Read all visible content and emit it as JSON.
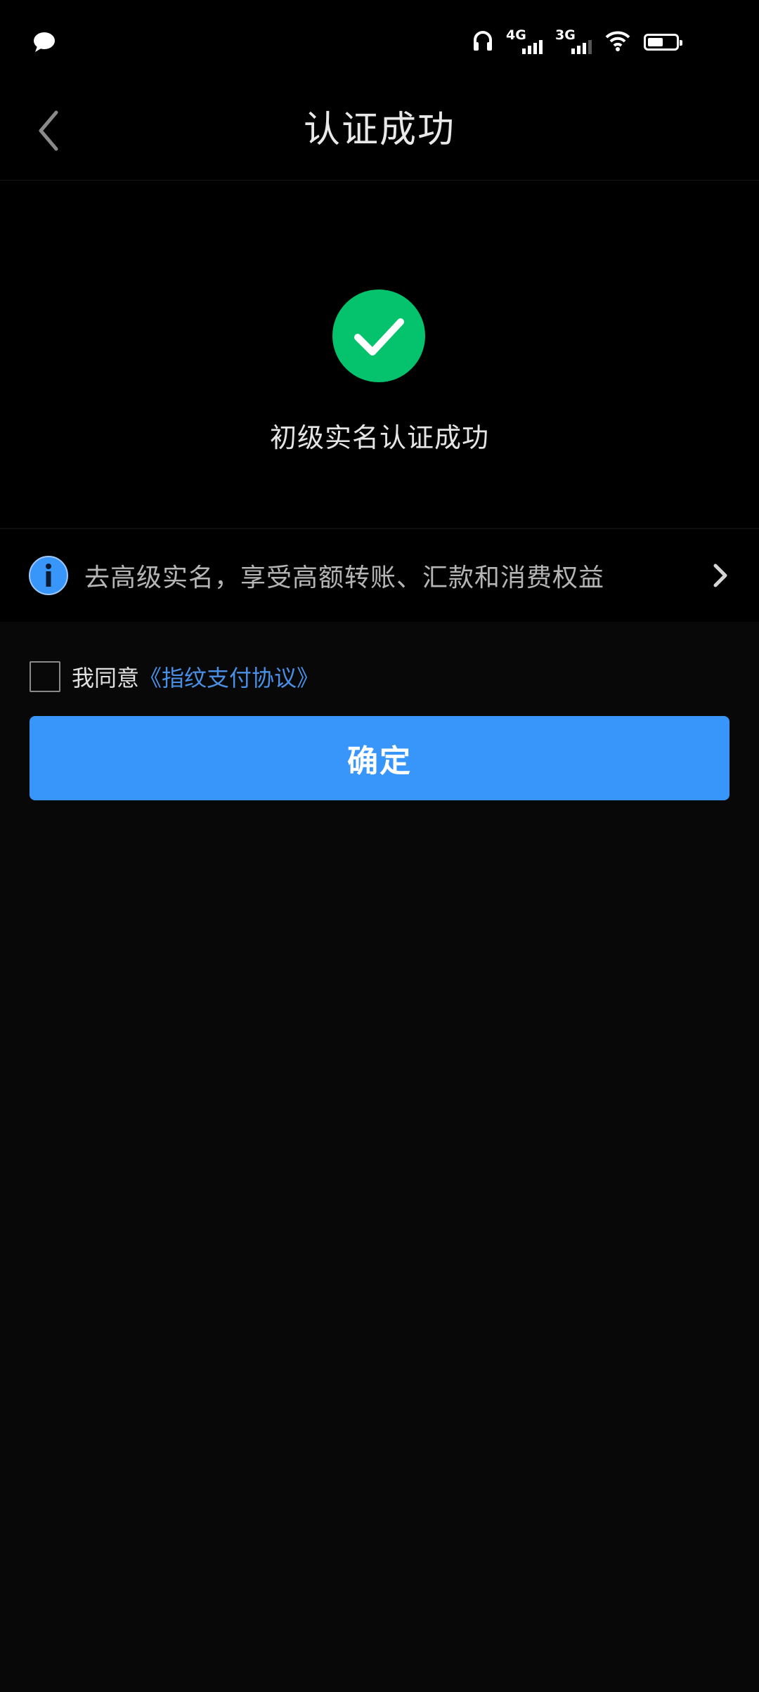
{
  "status_bar": {
    "icons": [
      "message-icon",
      "headphones-icon",
      "signal-4g-icon",
      "signal-3g-icon",
      "wifi-icon",
      "battery-icon"
    ],
    "sim1_label": "4G",
    "sim2_label": "3G",
    "battery_level": 0.55
  },
  "nav": {
    "title": "认证成功",
    "back_icon": "chevron-left-icon"
  },
  "result": {
    "icon": "check-circle-icon",
    "icon_color": "#05C36C",
    "message": "初级实名认证成功"
  },
  "upgrade_banner": {
    "icon": "info-icon",
    "icon_color": "#3896FA",
    "text": "去高级实名，享受高额转账、汇款和消费权益",
    "arrow_icon": "chevron-right-icon"
  },
  "agreement": {
    "checked": false,
    "prefix": "我同意",
    "link_text": "《指纹支付协议》",
    "link_color": "#4A8FE6"
  },
  "confirm_button": {
    "label": "确定",
    "color": "#3896FA"
  }
}
